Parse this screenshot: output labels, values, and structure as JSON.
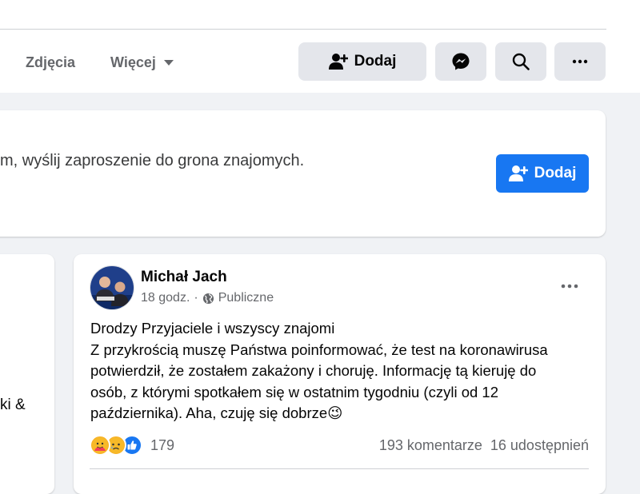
{
  "header": {
    "tabs": [
      {
        "label": "Zdjęcia"
      },
      {
        "label": "Więcej"
      }
    ],
    "add_button_label": "Dodaj",
    "icons": [
      "add-friend-icon",
      "messenger-icon",
      "search-icon",
      "more-dots-icon"
    ]
  },
  "suggestion": {
    "text": "m, wyślij zaproszenie do grona znajomych.",
    "add_button_label": "Dodaj"
  },
  "left_card": {
    "snippet": "ki &"
  },
  "post": {
    "author": "Michał Jach",
    "time": "18 godz.",
    "separator": "·",
    "audience": "Publiczne",
    "lines": [
      "Drodzy Przyjaciele i wszyscy znajomi",
      "Z przykrością muszę Państwa poinformować, że test na koronawirusa",
      "potwierdził, że zostałem zakażony i choruję. Informację tą kieruję do",
      "osób, z którymi spotkałem się w ostatnim tygodniu (czyli od 12",
      "października). Aha, czuję się dobrze"
    ],
    "emoji": "😉",
    "reaction_count": "179",
    "reactions": [
      "care",
      "sad",
      "like"
    ],
    "comments": "193 komentarze",
    "shares": "16 udostępnień"
  },
  "colors": {
    "brand_blue": "#1877f2",
    "background": "#f0f2f5",
    "secondary_text": "#65676b"
  }
}
